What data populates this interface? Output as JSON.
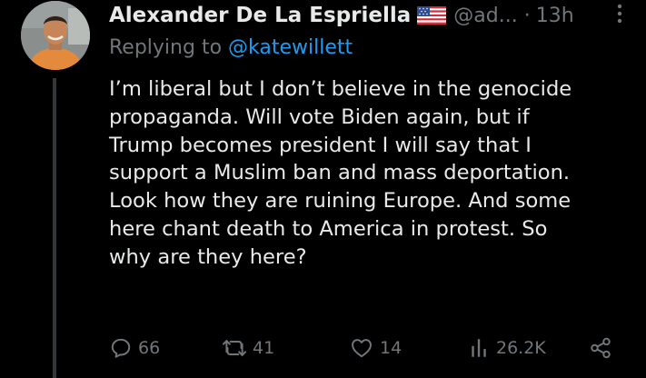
{
  "tweet": {
    "display_name": "Alexander De La Espriella",
    "flag": "us-flag-emoji",
    "handle": "@ad...",
    "separator": "·",
    "timestamp": "13h",
    "replying_prefix": "Replying to",
    "replying_to": "@katewillett",
    "text_lines": [
      "I’m liberal but I don’t believe in the genocide",
      "propaganda. Will vote Biden again, but if",
      "Trump becomes president I will say that I",
      "support a Muslim ban and mass deportation.",
      "Look how they are ruining Europe. And some",
      "here chant death to America in protest. So",
      "why are they here?"
    ]
  },
  "actions": {
    "replies": "66",
    "retweets": "41",
    "likes": "14",
    "views": "26.2K"
  },
  "icons": {
    "reply": "reply-icon",
    "retweet": "retweet-icon",
    "like": "heart-icon",
    "views": "views-bar-icon",
    "share": "share-icon",
    "more": "more-vertical-icon"
  },
  "colors": {
    "background": "#000000",
    "primary_text": "#e7e9ea",
    "secondary_text": "#71767b",
    "link": "#1d9bf0",
    "thread_line": "#333639"
  }
}
